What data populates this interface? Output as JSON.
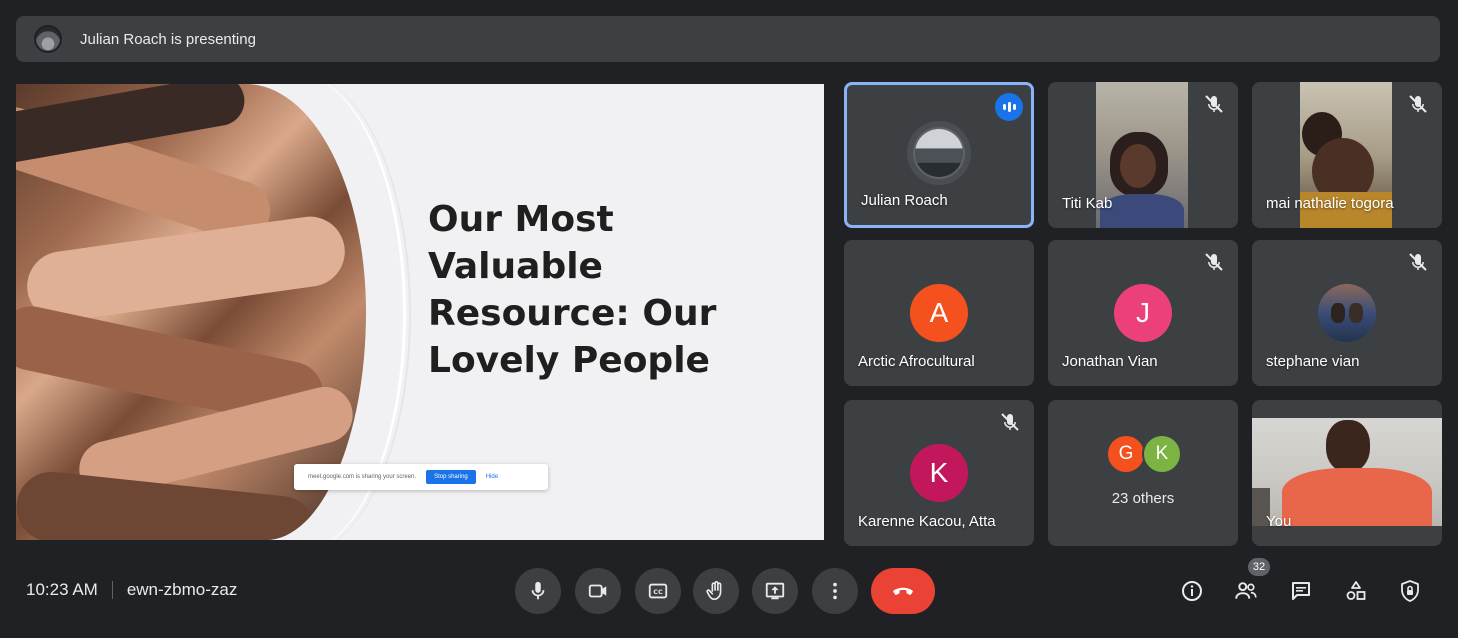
{
  "banner": {
    "presenting_text": "Julian Roach is presenting"
  },
  "slide": {
    "title": "Our Most Valuable Resource: Our Lovely People",
    "share_bar": {
      "message": "meet.google.com is sharing your screen.",
      "stop_label": "Stop sharing",
      "hide_label": "Hide"
    }
  },
  "participants": [
    {
      "name": "Julian Roach",
      "speaking": true
    },
    {
      "name": "Titi Kab",
      "muted": true
    },
    {
      "name": "mai nathalie togora",
      "muted": true
    },
    {
      "name": "Arctic Afrocultural",
      "initial": "A",
      "color": "#f4511e"
    },
    {
      "name": "Jonathan Vian",
      "initial": "J",
      "color": "#ec407a",
      "muted": true
    },
    {
      "name": "stephane vian",
      "muted": true
    },
    {
      "name": "Karenne Kacou, Atta",
      "initial": "K",
      "color": "#c2185b",
      "muted": true
    },
    {
      "name": "You"
    }
  ],
  "others": {
    "initials": [
      "G",
      "K"
    ],
    "colors": [
      "#f4511e",
      "#7cb342"
    ],
    "label": "23 others"
  },
  "meeting": {
    "time": "10:23 AM",
    "code": "ewn-zbmo-zaz"
  },
  "people_count": "32",
  "icons": [
    "mic-icon",
    "camera-icon",
    "captions-icon",
    "raise-hand-icon",
    "present-screen-icon",
    "more-options-icon",
    "end-call-icon",
    "info-icon",
    "people-icon",
    "chat-icon",
    "activities-icon",
    "host-controls-icon",
    "mute-icon"
  ]
}
